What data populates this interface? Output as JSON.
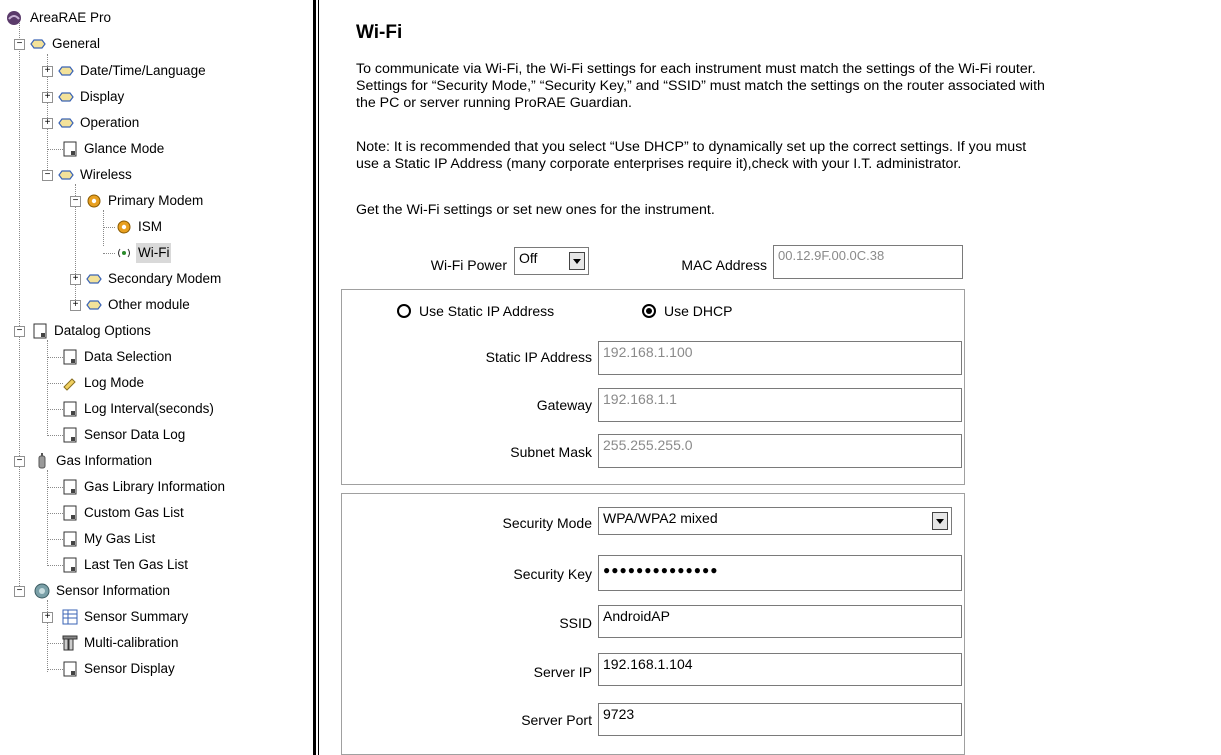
{
  "tree": {
    "root": "AreaRAE Pro",
    "general": "General",
    "date_time_language": "Date/Time/Language",
    "display": "Display",
    "operation": "Operation",
    "glance_mode": "Glance Mode",
    "wireless": "Wireless",
    "primary_modem": "Primary Modem",
    "ism": "ISM",
    "wifi": "Wi-Fi",
    "secondary_modem": "Secondary Modem",
    "other_module": "Other module",
    "datalog_options": "Datalog Options",
    "data_selection": "Data Selection",
    "log_mode": "Log Mode",
    "log_interval": "Log Interval(seconds)",
    "sensor_data_log": "Sensor Data Log",
    "gas_information": "Gas Information",
    "gas_library_information": "Gas Library Information",
    "custom_gas_list": "Custom Gas List",
    "my_gas_list": "My Gas List",
    "last_ten_gas_list": "Last Ten Gas List",
    "sensor_information": "Sensor Information",
    "sensor_summary": "Sensor Summary",
    "multi_calibration": "Multi-calibration",
    "sensor_display": "Sensor Display"
  },
  "content": {
    "title": "Wi-Fi",
    "para1_line1": "To communicate via Wi-Fi, the Wi-Fi settings for each instrument must match the settings of the Wi-Fi router.",
    "para1_line2": "Settings for “Security Mode,” “Security Key,” and “SSID” must match the settings on the router associated with",
    "para1_line3": "the PC or server running ProRAE Guardian.",
    "para2_line1": "Note: It is recommended that you select “Use DHCP” to dynamically set up the correct settings. If you must",
    "para2_line2": "use a Static IP Address (many corporate enterprises require it),check with your I.T. administrator.",
    "para3": "Get the Wi-Fi settings or set new ones for the instrument.",
    "wifi_power_label": "Wi-Fi Power",
    "wifi_power_value": "Off",
    "mac_address_label": "MAC Address",
    "mac_address_value": "00.12.9F.00.0C.38",
    "radio_static": "Use Static IP Address",
    "radio_dhcp": "Use DHCP",
    "static_ip_label": "Static IP Address",
    "static_ip_value": "192.168.1.100",
    "gateway_label": "Gateway",
    "gateway_value": "192.168.1.1",
    "subnet_label": "Subnet Mask",
    "subnet_value": "255.255.255.0",
    "security_mode_label": "Security Mode",
    "security_mode_value": "WPA/WPA2 mixed",
    "security_key_label": "Security Key",
    "security_key_value": "●●●●●●●●●●●●●●",
    "ssid_label": "SSID",
    "ssid_value": "AndroidAP",
    "server_ip_label": "Server IP",
    "server_ip_value": "192.168.1.104",
    "server_port_label": "Server Port",
    "server_port_value": "9723"
  }
}
